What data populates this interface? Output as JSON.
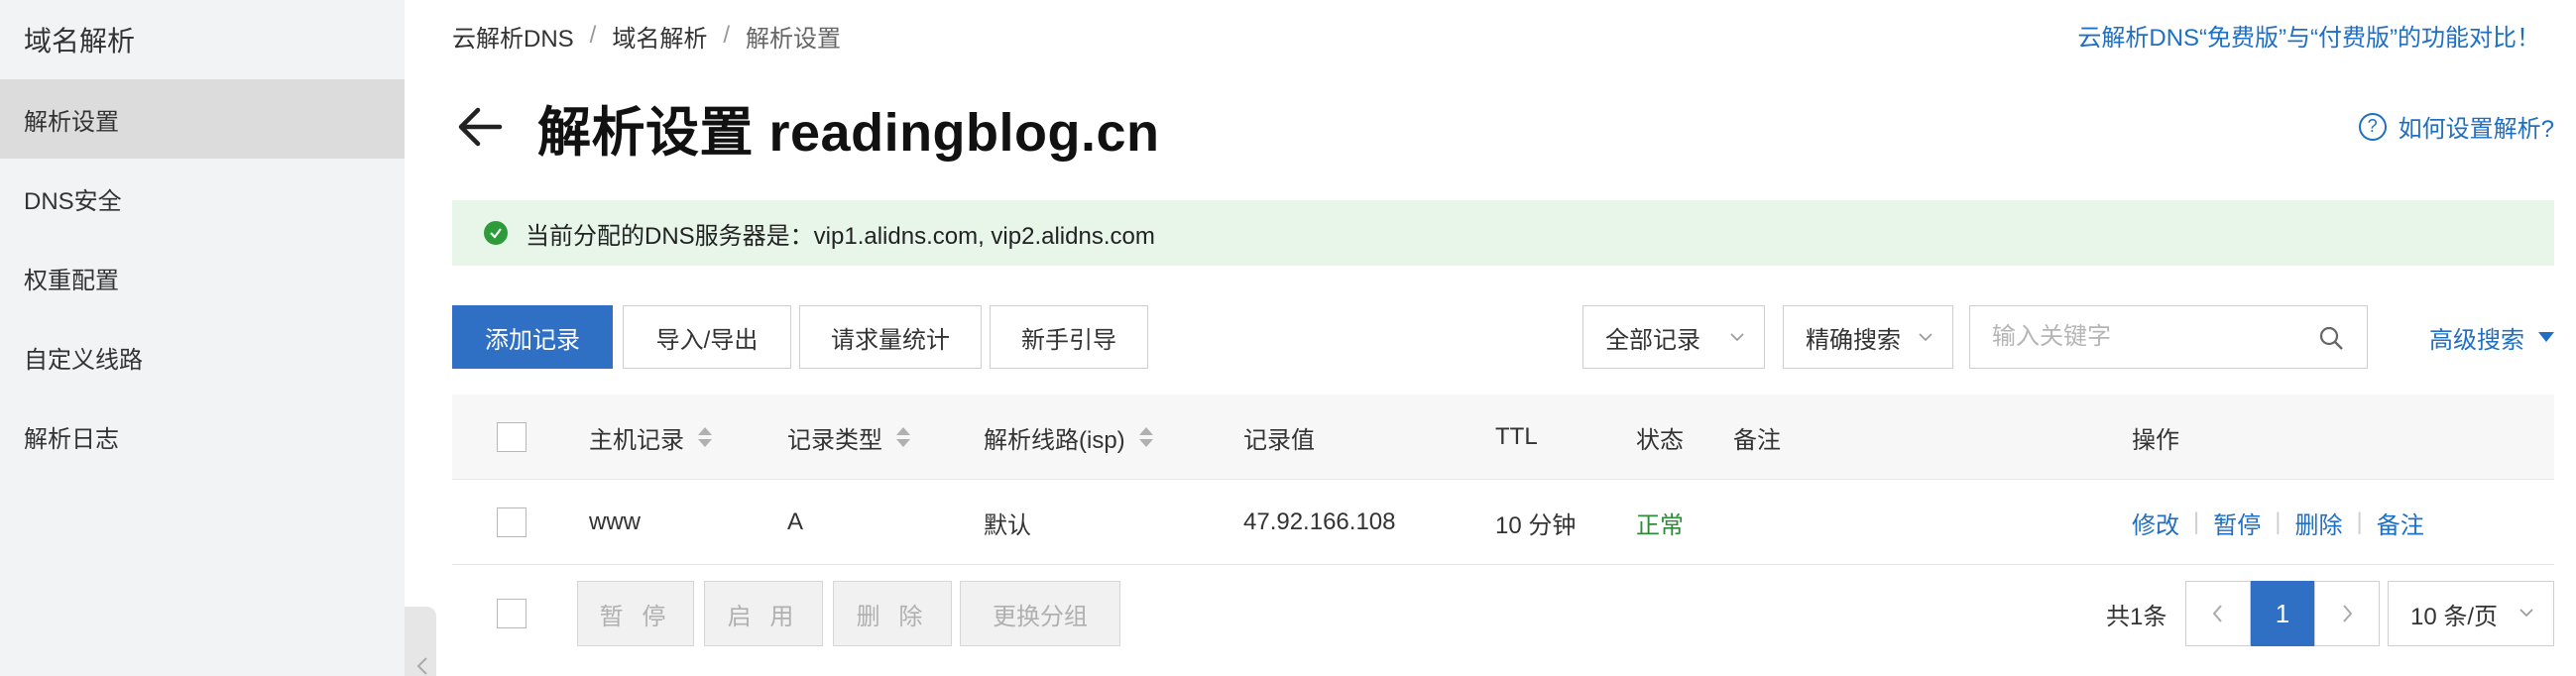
{
  "sidebar": {
    "title": "域名解析",
    "items": [
      {
        "label": "解析设置",
        "active": true
      },
      {
        "label": "DNS安全",
        "active": false
      },
      {
        "label": "权重配置",
        "active": false
      },
      {
        "label": "自定义线路",
        "active": false
      },
      {
        "label": "解析日志",
        "active": false
      }
    ]
  },
  "breadcrumb": {
    "items": [
      "云解析DNS",
      "域名解析",
      "解析设置"
    ],
    "separator": "/"
  },
  "compare_link": "云解析DNS“免费版”与“付费版”的功能对比！",
  "page": {
    "title": "解析设置 readingblog.cn",
    "help_link": "如何设置解析?",
    "help_icon": "?"
  },
  "alert": {
    "text": "当前分配的DNS服务器是：vip1.alidns.com, vip2.alidns.com"
  },
  "toolbar": {
    "add_record": "添加记录",
    "import_export": "导入/导出",
    "request_stats": "请求量统计",
    "beginner_guide": "新手引导",
    "record_filter": "全部记录",
    "search_mode": "精确搜索",
    "search_placeholder": "输入关键字",
    "advanced_search": "高级搜索"
  },
  "table": {
    "columns": [
      "主机记录",
      "记录类型",
      "解析线路(isp)",
      "记录值",
      "TTL",
      "状态",
      "备注",
      "操作"
    ],
    "rows": [
      {
        "host": "www",
        "type": "A",
        "line": "默认",
        "value": "47.92.166.108",
        "ttl": "10 分钟",
        "status": "正常",
        "remark": "",
        "actions": [
          "修改",
          "暂停",
          "删除",
          "备注"
        ]
      }
    ]
  },
  "footer": {
    "pause": "暂 停",
    "enable": "启 用",
    "delete": "删 除",
    "change_group": "更换分组",
    "total": "共1条",
    "current_page": "1",
    "page_size": "10 条/页"
  },
  "colors": {
    "primary": "#2f6fc4",
    "link": "#1f6fc2",
    "success": "#2e9b3a",
    "alert_bg": "#e8f6ea",
    "sidebar_bg": "#f2f3f5"
  }
}
